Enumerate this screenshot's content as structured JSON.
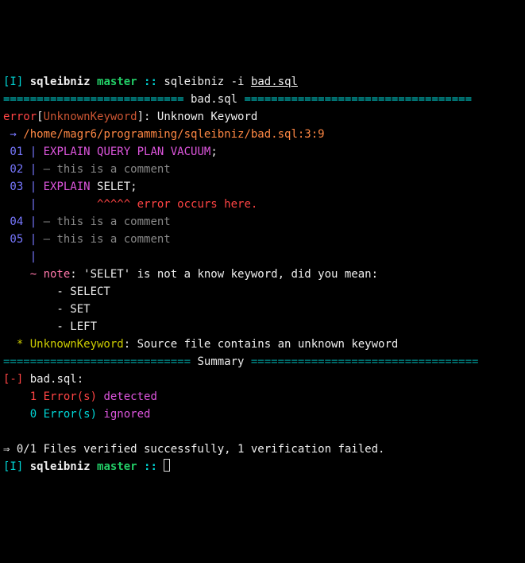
{
  "prompt1": {
    "mode": "[I]",
    "dir": "sqleibniz",
    "branch": "master",
    "sep": "::",
    "cmd": "sqleibniz -i",
    "file": "bad.sql"
  },
  "header": {
    "rule_l": "===========================",
    "title": " bad.sql ",
    "rule_r": "=================================="
  },
  "error": {
    "label": "error",
    "lb": "[",
    "code": "UnknownKeyword",
    "rb": "]",
    "colon": ": ",
    "msg": "Unknown Keyword"
  },
  "path": {
    "arrow": " → ",
    "value": "/home/magr6/programming/sqleibniz/bad.sql:3:9"
  },
  "lines": {
    "l01_num": " 01 ",
    "pipe": "|",
    "l01_code": " EXPLAIN QUERY PLAN VACUUM",
    "l01_semi": ";",
    "l02_num": " 02 ",
    "l02_txt": " — this is a comment",
    "l03_num": " 03 ",
    "l03_explain": " EXPLAIN",
    "l03_selet": " SELET",
    "l03_semi": ";",
    "empty_num": "    ",
    "caret_pad": "         ",
    "caret": "^^^^^ ",
    "caret_msg": "error occurs here.",
    "l04_num": " 04 ",
    "l04_txt": " — this is a comment",
    "l05_num": " 05 ",
    "l05_txt": " — this is a comment"
  },
  "note": {
    "tilde": "    ~ ",
    "label": "note",
    "colon": ": ",
    "msg": "'SELET' is not a know keyword, did you mean:",
    "s1": "        - SELECT",
    "s2": "        - SET",
    "s3": "        - LEFT"
  },
  "star": {
    "star": "  * ",
    "code": "UnknownKeyword",
    "colon": ": ",
    "msg": "Source file contains an unknown keyword"
  },
  "summary": {
    "rule_l": "============================",
    "title": " Summary ",
    "rule_r": "=================================="
  },
  "file_summary": {
    "marker": "[-]",
    "name": " bad.sql:",
    "err_count": "    1 ",
    "err_label": "Error(s) ",
    "detected": "detected",
    "ign_count": "    0 ",
    "ign_label": "Error(s) ",
    "ignored": "ignored"
  },
  "final": {
    "arrow": "⇒ ",
    "msg": "0/1 Files verified successfully, 1 verification failed."
  },
  "prompt2": {
    "mode": "[I]",
    "dir": "sqleibniz",
    "branch": "master",
    "sep": ":: "
  }
}
